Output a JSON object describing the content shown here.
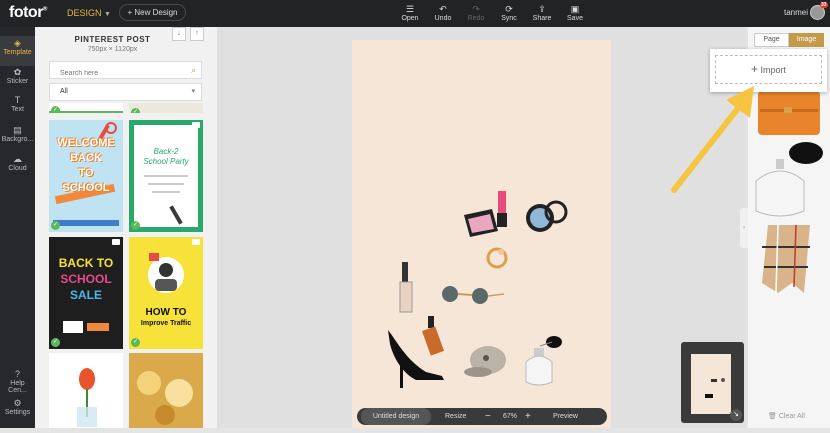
{
  "topbar": {
    "logo": "fotor",
    "design_label": "DESIGN",
    "new_design_label": "+ New Design",
    "tools": [
      {
        "label": "Open",
        "icon": "menu-icon",
        "glyph": "☰",
        "disabled": false
      },
      {
        "label": "Undo",
        "icon": "undo-icon",
        "glyph": "↶",
        "disabled": false
      },
      {
        "label": "Redo",
        "icon": "redo-icon",
        "glyph": "↷",
        "disabled": true
      },
      {
        "label": "Sync",
        "icon": "sync-icon",
        "glyph": "⟳",
        "disabled": false
      },
      {
        "label": "Share",
        "icon": "share-icon",
        "glyph": "⇪",
        "disabled": false
      },
      {
        "label": "Save",
        "icon": "save-icon",
        "glyph": "▣",
        "disabled": false
      }
    ],
    "username": "tanmei",
    "notification_count": "33"
  },
  "leftnav": [
    {
      "label": "Template",
      "icon": "template-icon",
      "glyph": "◈",
      "active": true
    },
    {
      "label": "Sticker",
      "icon": "sticker-icon",
      "glyph": "✿",
      "active": false
    },
    {
      "label": "Text",
      "icon": "text-icon",
      "glyph": "T",
      "active": false
    },
    {
      "label": "Backgro...",
      "icon": "background-icon",
      "glyph": "▤",
      "active": false
    },
    {
      "label": "Cloud",
      "icon": "cloud-icon",
      "glyph": "☁",
      "active": false
    },
    {
      "label": "Help Cen...",
      "icon": "help-icon",
      "glyph": "?",
      "active": false
    },
    {
      "label": "Settings",
      "icon": "settings-icon",
      "glyph": "⚙",
      "active": false
    }
  ],
  "template_panel": {
    "title": "PINTEREST POST",
    "size": "750px × 1120px",
    "search_placeholder": "Search here",
    "filter_value": "All",
    "thumbnails": [
      {
        "name": "welcome-back-to-school",
        "lines": [
          "WELCOME",
          "BACK",
          "TO",
          "SCHOOL"
        ],
        "bg": "#bfe3f2"
      },
      {
        "name": "back-2-school-party",
        "lines": [
          "Back-2",
          "School Party"
        ],
        "bg": "#ffffff"
      },
      {
        "name": "back-to-school-sale",
        "lines": [
          "BACK TO",
          "SCHOOL",
          "SALE"
        ],
        "bg": "#1e1e1e"
      },
      {
        "name": "how-to-improve-traffic",
        "lines": [
          "HOW TO",
          "Improve Traffic"
        ],
        "bg": "#f7e23a"
      }
    ]
  },
  "canvas": {
    "bottombar": {
      "title": "Untitled design",
      "resize": "Resize",
      "zoom": "67%",
      "preview": "Preview"
    }
  },
  "right_panel": {
    "tabs": [
      "Page",
      "Image"
    ],
    "active_tab": "Image",
    "import_label": "Import",
    "clear_all": "Clear All"
  },
  "colors": {
    "accent": "#e7b84a",
    "arrow": "#f5c542",
    "canvas_bg": "#f6e6d7"
  }
}
